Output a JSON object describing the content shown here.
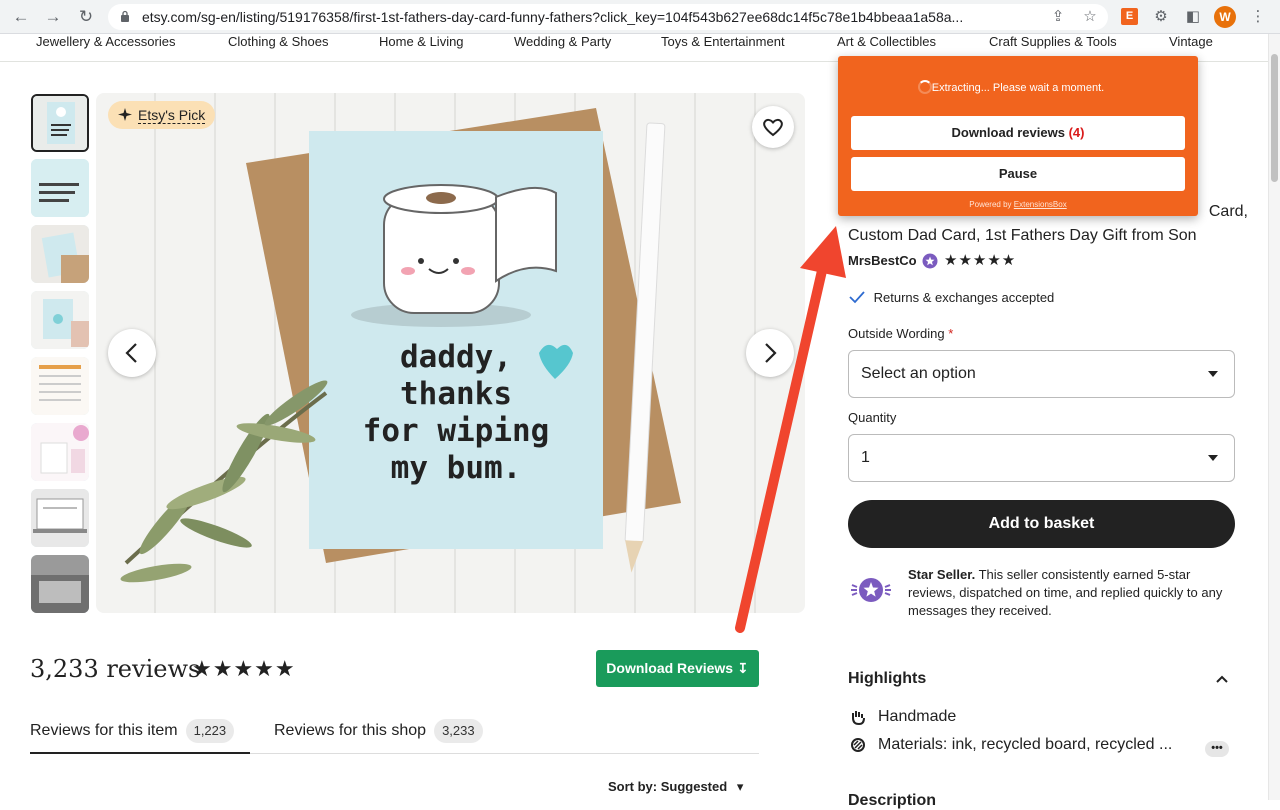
{
  "browser": {
    "url": "etsy.com/sg-en/listing/519176358/first-1st-fathers-day-card-funny-fathers?click_key=104f543b627ee68dc14f5c78e1b4bbeaa1a58a...",
    "profile_initial": "W",
    "ext_letter": "E"
  },
  "categories": [
    "Jewellery & Accessories",
    "Clothing & Shoes",
    "Home & Living",
    "Wedding & Party",
    "Toys & Entertainment",
    "Art & Collectibles",
    "Craft Supplies & Tools",
    "Vintage"
  ],
  "gallery": {
    "badge": "Etsy's Pick",
    "card_text_lines": [
      "daddy,",
      "thanks",
      "for wiping",
      "my bum."
    ]
  },
  "reviews": {
    "title": "3,233 reviews",
    "stars": "★★★★★",
    "download_label": "Download Reviews",
    "tabs": [
      {
        "label": "Reviews for this item",
        "count": "1,223"
      },
      {
        "label": "Reviews for this shop",
        "count": "3,233"
      }
    ],
    "sort_label": "Sort by: Suggested"
  },
  "product": {
    "title_visible": "Card, Custom Dad Card, 1st Fathers Day Gift from Son",
    "title_line1_tail": "Card,",
    "title_line2": "Custom Dad Card, 1st Fathers Day Gift from Son",
    "seller": "MrsBestCo",
    "seller_stars": "★★★★★",
    "returns": "Returns & exchanges accepted",
    "outside_wording_label": "Outside Wording",
    "required_mark": "*",
    "outside_wording_value": "Select an option",
    "quantity_label": "Quantity",
    "quantity_value": "1",
    "add_to_basket": "Add to basket",
    "star_seller_bold": "Star Seller.",
    "star_seller_text": "This seller consistently earned 5-star reviews, dispatched on time, and replied quickly to any messages they received.",
    "highlights_title": "Highlights",
    "highlights": [
      "Handmade",
      "Materials: ink, recycled board, recycled ..."
    ],
    "more_dots": "•••",
    "description_title": "Description"
  },
  "extension": {
    "status": "Extracting... Please wait a moment.",
    "download_label": "Download reviews",
    "download_count": "(4)",
    "pause_label": "Pause",
    "powered_by": "Powered by",
    "powered_link": "ExtensionsBox"
  },
  "colors": {
    "extension_orange": "#f1641e",
    "download_green": "#1a9b5b",
    "arrow_red": "#f0452e",
    "card_blue": "#cfe9ee"
  }
}
